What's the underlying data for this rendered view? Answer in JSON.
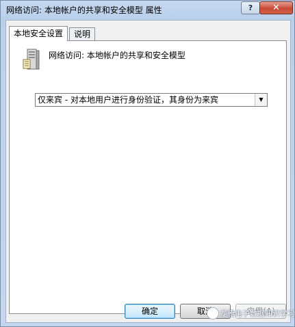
{
  "window": {
    "title": "网络访问: 本地帐户的共享和安全模型 属性",
    "help_label": "?",
    "close_label": "✕"
  },
  "tabs": [
    {
      "label": "本地安全设置",
      "active": true
    },
    {
      "label": "说明",
      "active": false
    }
  ],
  "policy": {
    "icon": "server-icon",
    "title": "网络访问: 本地帐户的共享和安全模型"
  },
  "select": {
    "value": "仅来宾 - 对本地用户进行身份验证，其身份为来宾"
  },
  "buttons": {
    "ok": "确定",
    "cancel": "取消",
    "apply": "应用(A)"
  },
  "watermark": {
    "text": "龙腾电子数据知识学习"
  },
  "colors": {
    "titlebar": "#bcd1ec",
    "close": "#c74a36",
    "default_button": "#3c7fb1"
  }
}
